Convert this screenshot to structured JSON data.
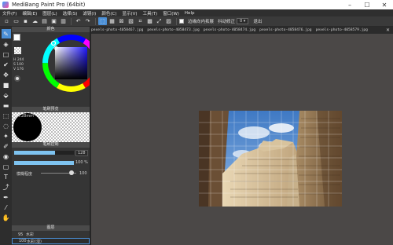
{
  "window": {
    "title": "MediBang Paint Pro (64bit)",
    "minimize_glyph": "–",
    "maximize_glyph": "☐",
    "close_glyph": "✕"
  },
  "menu": [
    "文件(F)",
    "编辑(E)",
    "图层(L)",
    "选择(S)",
    "滤镜(I)",
    "颜色(C)",
    "显示(V)",
    "工具(T)",
    "窗口(W)",
    "Help"
  ],
  "toolbar": {
    "antialias_label": "边缘向内拓展",
    "stabilizer_label": "抖动修正",
    "stabilizer_value": "0",
    "exit_label": "退出"
  },
  "color_panel": {
    "title": "颜色",
    "hue_marker_color": "#3030ff",
    "h": "H 244",
    "s": "S 100",
    "v": "V 176",
    "primary_color": "#ffffff",
    "secondary_color": "#1a1a1a"
  },
  "brush_preview": {
    "title": "笔刷预览",
    "size_label": "64.28mm"
  },
  "brush_control": {
    "title": "笔刷控制",
    "size_value": "128",
    "opacity_value": "100 %",
    "size_fill": 0.68,
    "opacity_fill": 1.0,
    "blur_label": "模糊程度",
    "blur_value": "100"
  },
  "layers_panel": {
    "title": "图层",
    "rows": [
      {
        "pct": "95",
        "name": "水彩"
      },
      {
        "pct": "100",
        "name": "水彩(湿)"
      }
    ]
  },
  "documents": {
    "tabs": [
      "pexels-photo-4058467.jpg",
      "pexels-photo-4058473.jpg",
      "pexels-photo-4058474.jpg",
      "pexels-photo-4058476.jpg",
      "pexels-photo-4058579.jpg"
    ],
    "close_glyph": "✕"
  },
  "colors": {
    "accent": "#4a8fd6",
    "canvas_bg": "#4b4847",
    "panel_bg": "#353535",
    "sky": "#5b8fd0"
  }
}
